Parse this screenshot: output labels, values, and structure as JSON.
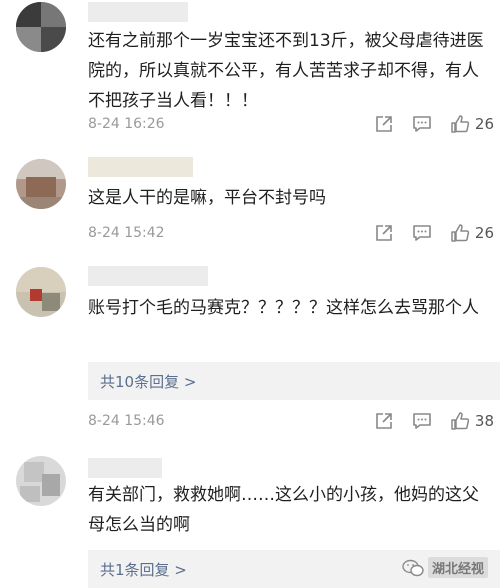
{
  "comments": [
    {
      "text": "还有之前那个一岁宝宝还不到13斤，被父母虐待进医院的，所以真就不公平，有人苦苦求子却不得，有人不把孩子当人看！！！",
      "time": "8-24 16:26",
      "likes": "26"
    },
    {
      "text": "这是人干的是嘛，平台不封号吗",
      "time": "8-24 15:42",
      "likes": "26"
    },
    {
      "text": "账号打个毛的马赛克？？？？？这样怎么去骂那个人",
      "reply_link": "共10条回复 >",
      "time": "8-24 15:46",
      "likes": "38"
    },
    {
      "text": "有关部门，救救她啊……这么小的小孩，他妈的这父母怎么当的啊",
      "reply_link": "共1条回复 >"
    }
  ],
  "watermark": {
    "text": "湖北经视"
  },
  "icons": {
    "share": "share-icon",
    "comment": "comment-icon",
    "like": "thumbs-up-icon",
    "watermark": "wechat-logo-icon"
  },
  "colors": {
    "text": "#1f1f1f",
    "meta": "#9a9a9a",
    "reply_link": "#5b6f8f",
    "reply_bg": "#f2f2f2"
  }
}
